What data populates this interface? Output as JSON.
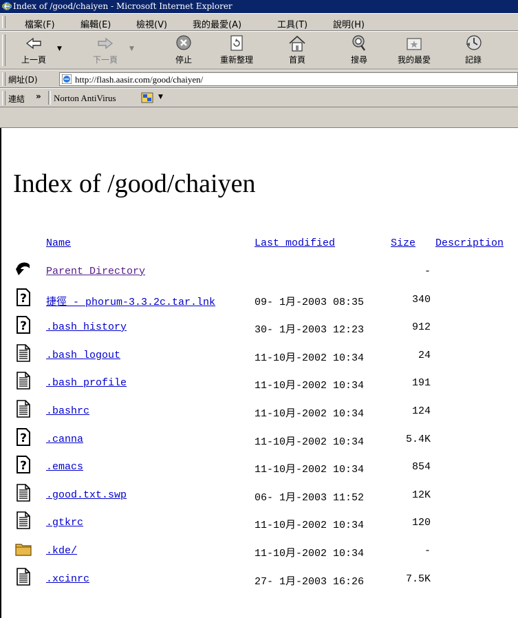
{
  "window": {
    "title": "Index of /good/chaiyen - Microsoft Internet Explorer"
  },
  "menubar": {
    "items": [
      "檔案(F)",
      "編輯(E)",
      "檢視(V)",
      "我的最愛(A)",
      "工具(T)",
      "說明(H)"
    ]
  },
  "toolbar": {
    "back": "上一頁",
    "forward": "下一頁",
    "stop": "停止",
    "refresh": "重新整理",
    "home": "首頁",
    "search": "搜尋",
    "favorites": "我的最愛",
    "history": "記錄"
  },
  "addressbar": {
    "label": "網址(D)",
    "url": "http://flash.aasir.com/good/chaiyen/"
  },
  "linksbar": {
    "label": "連結",
    "chevron": "»",
    "norton": "Norton AntiVirus"
  },
  "page": {
    "heading": "Index of /good/chaiyen",
    "columns": {
      "name": "Name",
      "modified": "Last modified",
      "size": "Size",
      "description": "Description"
    },
    "rows": [
      {
        "icon": "back-icon",
        "name": "Parent Directory",
        "modified": "",
        "size": "-"
      },
      {
        "icon": "unknown-file-icon",
        "name": "捷徑 - phorum-3.3.2c.tar.lnk",
        "modified": "09- 1月-2003 08:35",
        "size": "340"
      },
      {
        "icon": "unknown-file-icon",
        "name": ".bash_history",
        "modified": "30- 1月-2003 12:23",
        "size": "912"
      },
      {
        "icon": "text-file-icon",
        "name": ".bash_logout",
        "modified": "11-10月-2002 10:34",
        "size": "24"
      },
      {
        "icon": "text-file-icon",
        "name": ".bash_profile",
        "modified": "11-10月-2002 10:34",
        "size": "191"
      },
      {
        "icon": "text-file-icon",
        "name": ".bashrc",
        "modified": "11-10月-2002 10:34",
        "size": "124"
      },
      {
        "icon": "unknown-file-icon",
        "name": ".canna",
        "modified": "11-10月-2002 10:34",
        "size": "5.4K"
      },
      {
        "icon": "unknown-file-icon",
        "name": ".emacs",
        "modified": "11-10月-2002 10:34",
        "size": "854"
      },
      {
        "icon": "text-file-icon",
        "name": ".good.txt.swp",
        "modified": "06- 1月-2003 11:52",
        "size": "12K"
      },
      {
        "icon": "text-file-icon",
        "name": ".gtkrc",
        "modified": "11-10月-2002 10:34",
        "size": "120"
      },
      {
        "icon": "folder-icon",
        "name": ".kde/",
        "modified": "11-10月-2002 10:34",
        "size": "-"
      },
      {
        "icon": "text-file-icon",
        "name": ".xcinrc",
        "modified": "27- 1月-2003 16:26",
        "size": "7.5K"
      }
    ]
  },
  "colors": {
    "titlebar": "#0a246a",
    "chrome": "#d4d0c8",
    "link": "#0000cc",
    "visited": "#551a8b"
  }
}
